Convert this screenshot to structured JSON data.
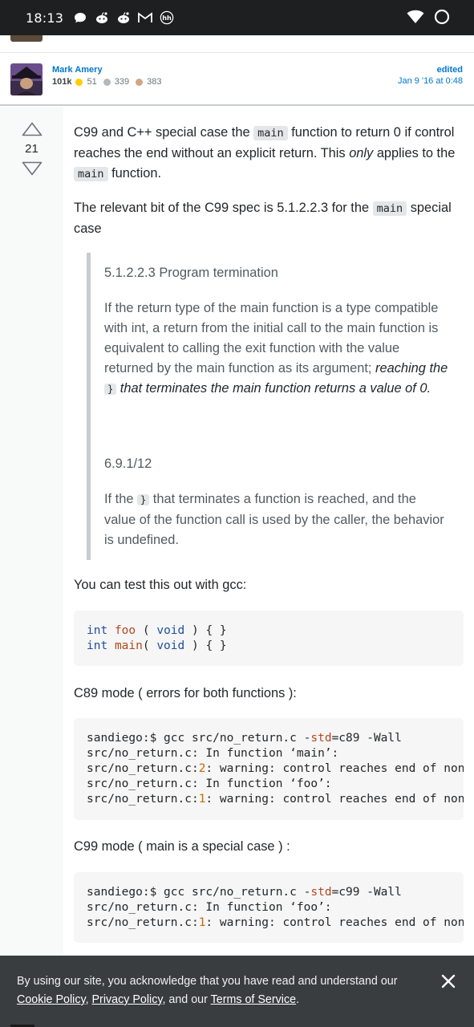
{
  "status_bar": {
    "time": "18:13",
    "icons": [
      "chat-bubble-icon",
      "reddit-icon",
      "reddit-icon",
      "gmail-icon",
      "hh-icon"
    ],
    "right_icons": [
      "wifi-icon",
      "loading-ring-icon"
    ],
    "hh_label": "hh"
  },
  "user_card": {
    "name": "Mark Amery",
    "reputation": "101k",
    "gold_badges": "51",
    "silver_badges": "339",
    "bronze_badges": "383",
    "edited_label": "edited",
    "edited_time": "Jan 9 '16 at 0:48",
    "colors": {
      "gold": "#ffcc01",
      "silver": "#b4b8bc",
      "bronze": "#d1a684"
    }
  },
  "post": {
    "vote_count": "21",
    "p1": {
      "t1": "C99 and C++ special case the ",
      "c1": "main",
      "t2": " function to return 0 if control reaches the end without an explicit return. This ",
      "em": "only",
      "t3": " applies to the ",
      "c2": "main",
      "t4": " function."
    },
    "p2": {
      "t1": "The relevant bit of the C99 spec is 5.1.2.2.3 for the ",
      "c1": "main",
      "t2": " special case"
    },
    "quote": {
      "heading1": "5.1.2.2.3 Program termination",
      "body1_a": "If the return type of the main function is a type compatible with int, a return from the initial call to the main function is equivalent to calling the exit function with the value",
      "body1_b": "returned by the main function as its argument; ",
      "body1_em1": "reaching the ",
      "body1_code": "}",
      "body1_em2": " that terminates the main function returns a value of 0.",
      "heading2": "6.9.1/12",
      "body2_a": "If the ",
      "body2_code": "}",
      "body2_b": " that terminates a function is reached, and the value of the function call is used by the caller, the behavior is undefined."
    },
    "p3": "You can test this out with gcc:",
    "code1": {
      "l1_kw": "int",
      "l1_fn": "foo",
      "l1_mid": " ( ",
      "l1_kw2": "void",
      "l1_end": " ) { }",
      "l2_kw": "int",
      "l2_fn": "main",
      "l2_mid": "( ",
      "l2_kw2": "void",
      "l2_end": " ) { }"
    },
    "p4": "C89 mode ( errors for both functions ):",
    "code2": {
      "l1_a": "sandiego:$ gcc src/no_return.c -",
      "l1_op": "std",
      "l1_b": "=c89 -Wall",
      "l2": "src/no_return.c: In function ‘main’:",
      "l3_a": "src/no_return.c:",
      "l3_n": "2",
      "l3_b": ": warning: control reaches end of non",
      "l4": "src/no_return.c: In function ‘foo’:",
      "l5_a": "src/no_return.c:",
      "l5_n": "1",
      "l5_b": ": warning: control reaches end of non"
    },
    "p5": "C99 mode ( main is a special case ) :",
    "code3": {
      "l1_a": "sandiego:$ gcc src/no_return.c -",
      "l1_op": "std",
      "l1_b": "=c99 -Wall",
      "l2": "src/no_return.c: In function ‘foo’:",
      "l3_a": "src/no_return.c:",
      "l3_n": "1",
      "l3_b": ": warning: control reaches end of non"
    }
  },
  "cookie_banner": {
    "t1": "By using our site, you acknowledge that you have read and understand our ",
    "cookie_link": "Cookie Policy",
    "sep1": ", ",
    "privacy_link": "Privacy Policy",
    "t2": ", and our ",
    "terms_link": "Terms of Service",
    "t3": "."
  }
}
